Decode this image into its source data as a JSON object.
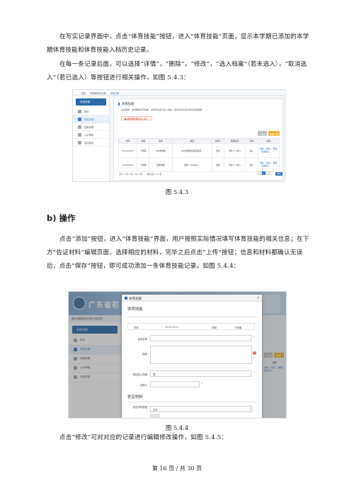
{
  "intro": {
    "p1": "在写实记录界面中，点击“体育技能”按钮，进入“体育技能”页面，显示本学期已添加的本学期体育技能和体育技能入档历史记录。",
    "p2": "在每一条记录后面，可以选择“详情”，“删除”，“修改”，“选入档案”（若未选入），“取消选入”（若已选入）等按钮进行相关操作，如图 5.4.3："
  },
  "figure1": {
    "caption": "图 5.4.3",
    "crumbs": [
      "首页",
      "纳税和特长记录",
      "写实记录"
    ],
    "sidebar_title": "系统导航",
    "sidebar_items": [
      "首页",
      "写实记录",
      "档案查看",
      "公示审核",
      "活动参加"
    ],
    "panel_title": "体育技能",
    "notice": "注意事项：本学期的体育技能，本学年最多可选入档案，其余请在写实记录中直接撤销…",
    "warning": "● 每学期选择最多入档…",
    "add_label": "+ 添加",
    "yellow_label": "新增入档",
    "table": {
      "headers": [
        "学年",
        "学期",
        "名称",
        "描述",
        "证明人",
        "数据来源",
        "状态",
        "操作"
      ],
      "rows": [
        [
          "2018-2019",
          "下学期",
          "100米短跑",
          "100米短跑比赛获得冠…",
          "班长",
          "学生个人录入",
          "选入",
          "详情 ｜修改 ｜删除 ｜取消选入"
        ],
        [
          "2018-2019",
          "下学期",
          "篮球技能",
          "篮球（football…",
          "班长",
          "学生个人录入",
          "选入",
          "详情 ｜修改 ｜删除 ｜取消选入"
        ]
      ]
    },
    "pager_info": "显示 1 到 2 项，共 2 项",
    "page_size": "每页显示 10 条",
    "pages": [
      "‹",
      "1",
      "›"
    ],
    "go_label": "跳转"
  },
  "section_b": {
    "heading": "b) 操作",
    "p1": "点击“添加”按钮，进入“体育技能”界面，用户按照实际情况填写体育技能的相关信息；在下方“佐证材料”编辑页面，选择相应的材料，完毕之后点击“上传”按钮；信息和材料都确认无误后，点击“保存”按钮，即可成功添加一条体育技能记录。如图 5.4.4："
  },
  "figure2": {
    "caption": "图 5.4.4",
    "banner_title": "广东省初",
    "crumb": "首页  纳税和特长记录  写实记录",
    "modal_title": "体育技能",
    "section_title": "体育技能",
    "grid_headers": [
      "学年",
      "2018-2019",
      "学期",
      "下学期"
    ],
    "fields": [
      {
        "label": "运动名称",
        "value": "",
        "required": "*"
      },
      {
        "label": "描述",
        "value": "",
        "required": "*"
      },
      {
        "label": "是否选入档案",
        "value": "是",
        "required": "*"
      },
      {
        "label": "证明人",
        "value": "",
        "required": "*"
      }
    ],
    "evidence_title": "佐证材料",
    "evidence_field": {
      "label": "佐证材料类型",
      "value": "文件"
    },
    "bg_right": {
      "add": "+ 添加",
      "new": "新增",
      "ops_header": "操作",
      "ops": "详情 ｜修改 ｜删除 ｜取消选入"
    }
  },
  "outro": {
    "p1": "点击“修改”可对对应的记录进行编辑修改操作，如图 5.4.5："
  },
  "footer": "第 16 页 / 共 30 页"
}
